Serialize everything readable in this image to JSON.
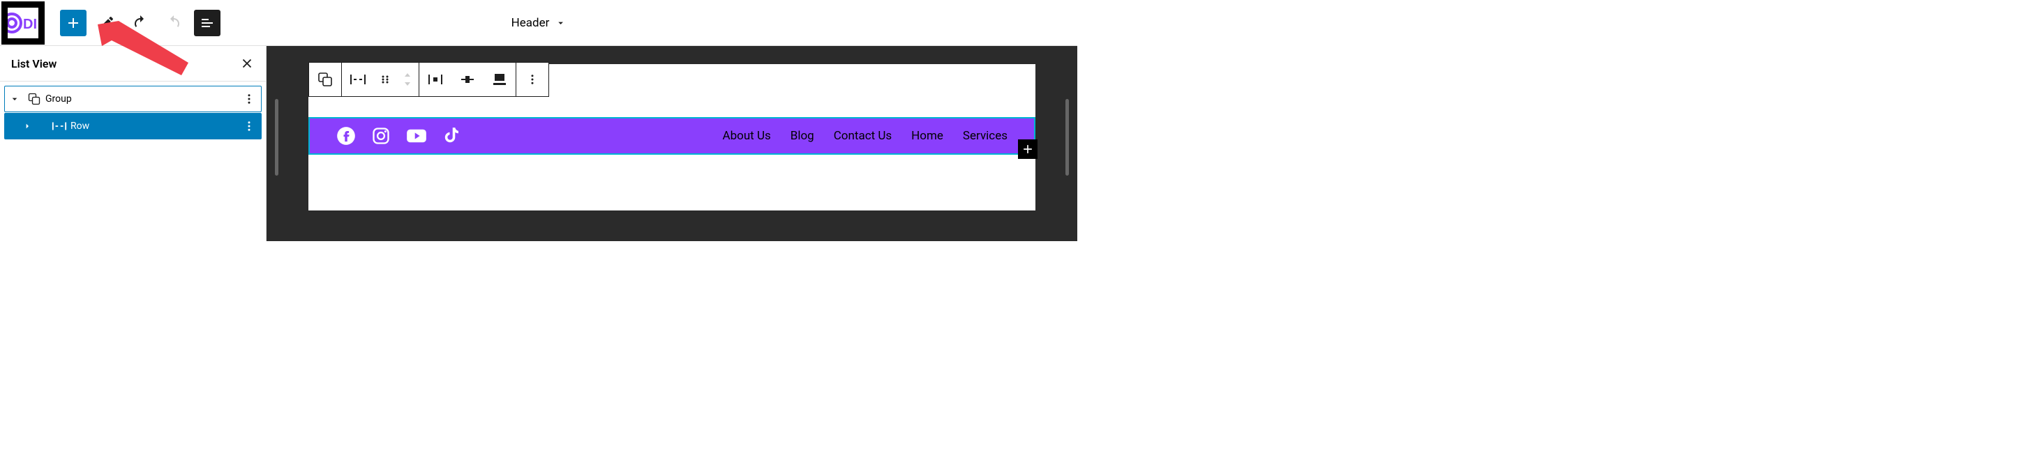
{
  "topbar": {
    "doc_title": "Header"
  },
  "sidebar": {
    "title": "List View",
    "tree": [
      {
        "label": "Group",
        "icon": "group-icon",
        "selected": "outline"
      },
      {
        "label": "Row",
        "icon": "row-icon",
        "selected": "fill"
      }
    ]
  },
  "header_block": {
    "social": [
      "facebook",
      "instagram",
      "youtube",
      "tiktok"
    ],
    "nav": [
      "About Us",
      "Blog",
      "Contact Us",
      "Home",
      "Services"
    ]
  }
}
